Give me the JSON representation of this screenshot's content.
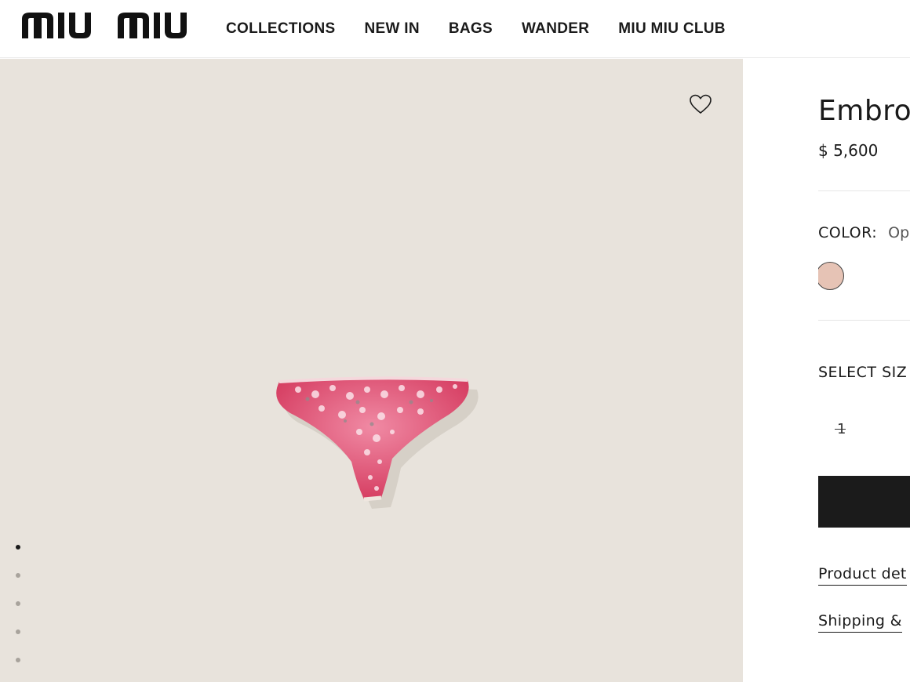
{
  "brand": {
    "logo_text": "MIU MIU"
  },
  "nav": {
    "items": [
      {
        "label": "COLLECTIONS"
      },
      {
        "label": "NEW IN"
      },
      {
        "label": "BAGS"
      },
      {
        "label": "WANDER"
      },
      {
        "label": "MIU MIU CLUB"
      }
    ]
  },
  "gallery": {
    "slide_count": 5,
    "active_index": 0,
    "background": "#e8e3dc"
  },
  "product": {
    "title": "Embro",
    "price": "$ 5,600",
    "color_label": "COLOR:",
    "color_value": "Op",
    "swatch_color": "#e6c3b5",
    "size_label": "SELECT SIZ",
    "sizes": [
      {
        "label": "1",
        "available": false
      }
    ]
  },
  "links": {
    "details": "Product det",
    "shipping": "Shipping &"
  },
  "colors": {
    "accent": "#1b1b1b",
    "text": "#1a1a1a"
  }
}
